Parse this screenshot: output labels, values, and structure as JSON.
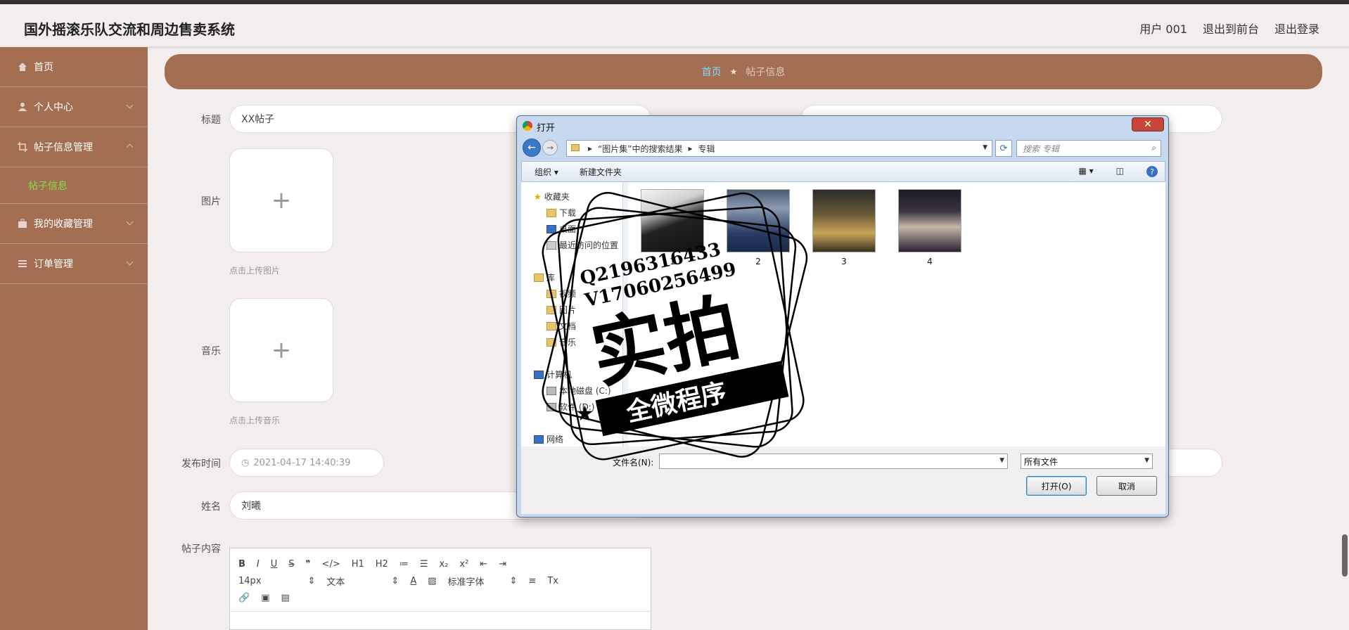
{
  "header": {
    "title": "国外摇滚乐队交流和周边售卖系统",
    "user": "用户 001",
    "to_front": "退出到前台",
    "logout": "退出登录"
  },
  "sidebar": {
    "items": [
      {
        "label": "首页",
        "icon": "home-icon"
      },
      {
        "label": "个人中心",
        "icon": "user-icon"
      },
      {
        "label": "帖子信息管理",
        "icon": "crop-icon"
      },
      {
        "label": "帖子信息",
        "icon": ""
      },
      {
        "label": "我的收藏管理",
        "icon": "briefcase-icon"
      },
      {
        "label": "订单管理",
        "icon": "list-icon"
      }
    ]
  },
  "breadcrumb": {
    "home": "首页",
    "current": "帖子信息"
  },
  "form": {
    "title_label": "标题",
    "title_value": "XX帖子",
    "image_label": "图片",
    "image_hint": "点击上传图片",
    "music_label": "音乐",
    "music_hint": "点击上传音乐",
    "time_label": "发布时间",
    "time_value": "2021-04-17 14:40:39",
    "name_label": "姓名",
    "name_value": "刘曦",
    "content_label": "帖子内容"
  },
  "editor": {
    "row1": [
      "B",
      "I",
      "U",
      "S",
      "❞",
      "</>",
      "H1",
      "H2",
      "≔",
      "☰",
      "x₂",
      "x²",
      "⇤",
      "⇥"
    ],
    "font_size": "14px",
    "text_style": "文本",
    "color_a": "A",
    "font_family": "标准字体"
  },
  "dialog": {
    "title": "打开",
    "close": "✕",
    "path_1": "“图片集”中的搜索结果",
    "path_2": "专辑",
    "search_placeholder": "搜索 专辑",
    "organize": "组织 ▾",
    "new_folder": "新建文件夹",
    "nav": {
      "favorites": "收藏夹",
      "downloads": "下载",
      "desktop": "桌面",
      "recent": "最近访问的位置",
      "library": "库",
      "video": "视频",
      "pictures": "图片",
      "documents": "文档",
      "music": "音乐",
      "computer": "计算机",
      "disk_c": "本地磁盘 (C:)",
      "disk_d": "软件 (D:)",
      "network": "网络"
    },
    "files": [
      "1",
      "2",
      "3",
      "4"
    ],
    "filename_label": "文件名(N):",
    "filetype": "所有文件",
    "open": "打开(O)",
    "cancel": "取消"
  },
  "watermark": {
    "line1": "Q2196316433",
    "line2": "V17060256499",
    "big": "实拍",
    "ribbon": "全微程序"
  },
  "colors": {
    "sidebar": "#a36e52",
    "accent_green": "#7fe04a",
    "crumb_link": "#7ed9ff"
  }
}
